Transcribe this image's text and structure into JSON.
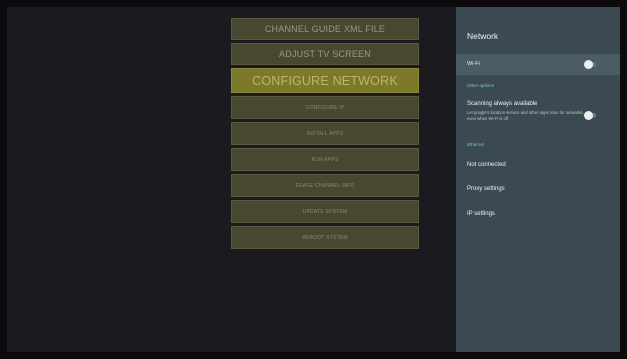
{
  "menu": {
    "items": [
      {
        "label": "CHANNEL GUIDE XML FILE"
      },
      {
        "label": "ADJUST TV SCREEN"
      },
      {
        "label": "CONFIGURE NETWORK"
      },
      {
        "label": "CONFIGURE IP"
      },
      {
        "label": "INSTALL APPS"
      },
      {
        "label": "RUN APPS"
      },
      {
        "label": "ERASE CHANNEL INFO"
      },
      {
        "label": "UPDATE SYSTEM"
      },
      {
        "label": "REBOOT SYSTEM"
      }
    ],
    "selected": "CONFIGURE NETWORK"
  },
  "panel": {
    "title": "Network",
    "wifi": {
      "label": "Wi-Fi",
      "enabled": false
    },
    "other_options_label": "Other options",
    "scanning": {
      "title": "Scanning always available",
      "description": "Let google's location service and other apps scan for networks, even when Wi-Fi is off",
      "enabled": false
    },
    "ethernet_label": "Ethernet",
    "ethernet_status": "Not connected",
    "proxy_settings": "Proxy settings",
    "ip_settings": "IP settings"
  },
  "colors": {
    "panel_bg": "#3b4a52",
    "section_accent": "#7fc4c4",
    "menu_selected": "#7c7a2a"
  }
}
